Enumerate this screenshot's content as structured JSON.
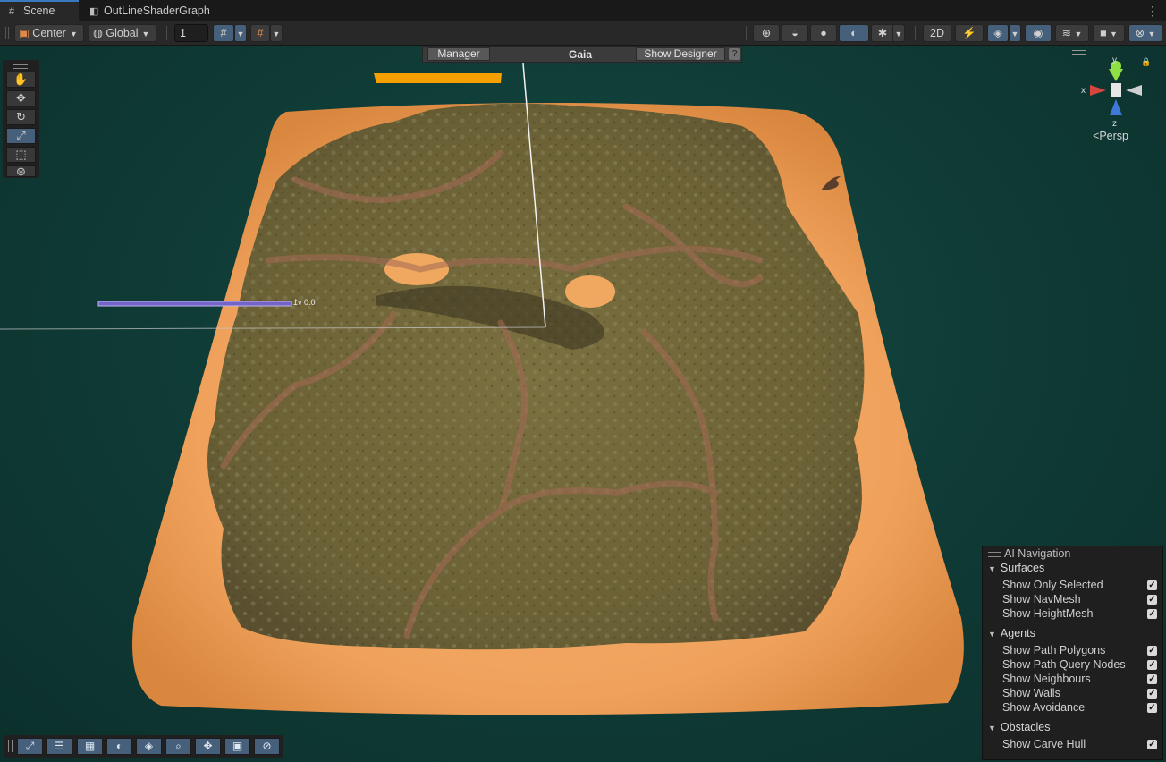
{
  "tabs": [
    {
      "label": "Scene",
      "icon": "grid-icon",
      "active": true
    },
    {
      "label": "OutLineShaderGraph",
      "icon": "shader-graph-icon",
      "active": false
    }
  ],
  "tab_menu_icon": "⋮",
  "toolbar": {
    "pivot_label": "Center",
    "handle_label": "Global",
    "snap_increment_value": "1"
  },
  "gaia": {
    "manager_label": "Manager",
    "title": "Gaia",
    "designer_label": "Show Designer",
    "help_label": "?"
  },
  "overlay_label": "0.0 v1",
  "gizmo": {
    "y_label": "y",
    "x_label": "x",
    "z_label": "z",
    "projection_label": "Persp",
    "colors": {
      "x": "#d6463f",
      "y": "#8ee043",
      "z": "#3f78d6"
    }
  },
  "ai_navigation": {
    "title": "AI Navigation",
    "sections": [
      {
        "label": "Surfaces",
        "options": [
          {
            "label": "Show Only Selected",
            "checked": true
          },
          {
            "label": "Show NavMesh",
            "checked": true
          },
          {
            "label": "Show HeightMesh",
            "checked": true
          }
        ]
      },
      {
        "label": "Agents",
        "options": [
          {
            "label": "Show Path Polygons",
            "checked": true
          },
          {
            "label": "Show Path Query Nodes",
            "checked": true
          },
          {
            "label": "Show Neighbours",
            "checked": true
          },
          {
            "label": "Show Walls",
            "checked": true
          },
          {
            "label": "Show Avoidance",
            "checked": true
          }
        ]
      },
      {
        "label": "Obstacles",
        "options": [
          {
            "label": "Show Carve Hull",
            "checked": true
          }
        ]
      }
    ]
  },
  "colors": {
    "accent": "#46607c",
    "sand": "#f0a860",
    "grass": "#6e6434",
    "water": "#0f3a35",
    "progress": "#f5a000"
  }
}
